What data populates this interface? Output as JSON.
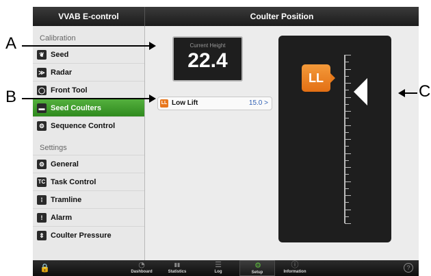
{
  "app": {
    "title": "VVAB E-control",
    "panel_title": "Coulter Position"
  },
  "sidebar": {
    "sections": [
      {
        "title": "Calibration",
        "items": [
          {
            "label": "Seed",
            "icon": "seed-icon",
            "glyph": "❦"
          },
          {
            "label": "Radar",
            "icon": "radar-icon",
            "glyph": "≫"
          },
          {
            "label": "Front Tool",
            "icon": "front-tool-icon",
            "glyph": "◯"
          },
          {
            "label": "Seed Coulters",
            "icon": "seed-coulters-icon",
            "glyph": "▬",
            "active": true
          },
          {
            "label": "Sequence Control",
            "icon": "sequence-control-icon",
            "glyph": "⚙"
          }
        ]
      },
      {
        "title": "Settings",
        "items": [
          {
            "label": "General",
            "icon": "gears-icon",
            "glyph": "⚙"
          },
          {
            "label": "Task Control",
            "icon": "task-control-icon",
            "glyph": "TC"
          },
          {
            "label": "Tramline",
            "icon": "tramline-icon",
            "glyph": "⁞"
          },
          {
            "label": "Alarm",
            "icon": "alarm-icon",
            "glyph": "!"
          },
          {
            "label": "Coulter Pressure",
            "icon": "coulter-pressure-icon",
            "glyph": "⇕"
          }
        ]
      }
    ]
  },
  "main": {
    "height_box": {
      "caption": "Current Height",
      "value": "22.4"
    },
    "low_lift": {
      "badge": "LL",
      "label": "Low Lift",
      "value": "15.0 >"
    },
    "gauge": {
      "badge": "LL"
    }
  },
  "annotations": {
    "a": "A",
    "b": "B",
    "c": "C"
  },
  "bottom_tabs": [
    {
      "label": "Dashboard",
      "icon": "dashboard-icon",
      "glyph": "◔"
    },
    {
      "label": "Statistics",
      "icon": "statistics-icon",
      "glyph": "▮▮"
    },
    {
      "label": "Log",
      "icon": "log-icon",
      "glyph": "☰"
    },
    {
      "label": "Setup",
      "icon": "setup-gears-icon",
      "glyph": "⚙",
      "selected": true
    },
    {
      "label": "Information",
      "icon": "information-icon",
      "glyph": "ⓘ"
    }
  ],
  "help": "?",
  "lock_glyph": "🔒",
  "colors": {
    "active_green": "#3a9a28",
    "orange": "#e8771d",
    "link_blue": "#2e5fb4"
  }
}
